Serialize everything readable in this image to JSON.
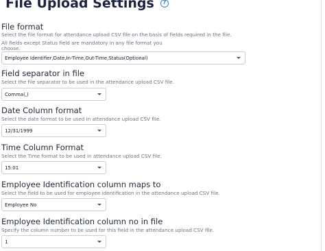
{
  "page": {
    "title": "File Upload Settings",
    "help_icon": "question-circle-icon"
  },
  "fields": [
    {
      "label": "File format",
      "help_lines": [
        "Select the file format for attendance upload CSV file on the basis of fields required in the file.",
        "All fields except Status field are mandatory in any file format you",
        "choose."
      ],
      "value": "Employee Identifier,Date,In-Time,Out-Time,Status(Optional)"
    },
    {
      "label": "Field separator in file",
      "help_lines": [
        "Select the file separator to be used in the attendance upload CSV file."
      ],
      "value": "Comma(,)"
    },
    {
      "label": "Date Column format",
      "help_lines": [
        "Select the date format to be used in attendance upload CSV file."
      ],
      "value": "12/31/1999"
    },
    {
      "label": "Time Column Format",
      "help_lines": [
        "Select the Time format to be used in attendance upload CSV file."
      ],
      "value": "15:01"
    },
    {
      "label": "Employee Identification column maps to",
      "help_lines": [
        "Select the field to be used for employee identification in the attendance upload CSV file."
      ],
      "value": "Employee No"
    },
    {
      "label": "Employee Identification column no in file",
      "help_lines": [
        "Specify the column number to be used for this field in the attendance upload CSV file."
      ],
      "value": "1"
    }
  ]
}
